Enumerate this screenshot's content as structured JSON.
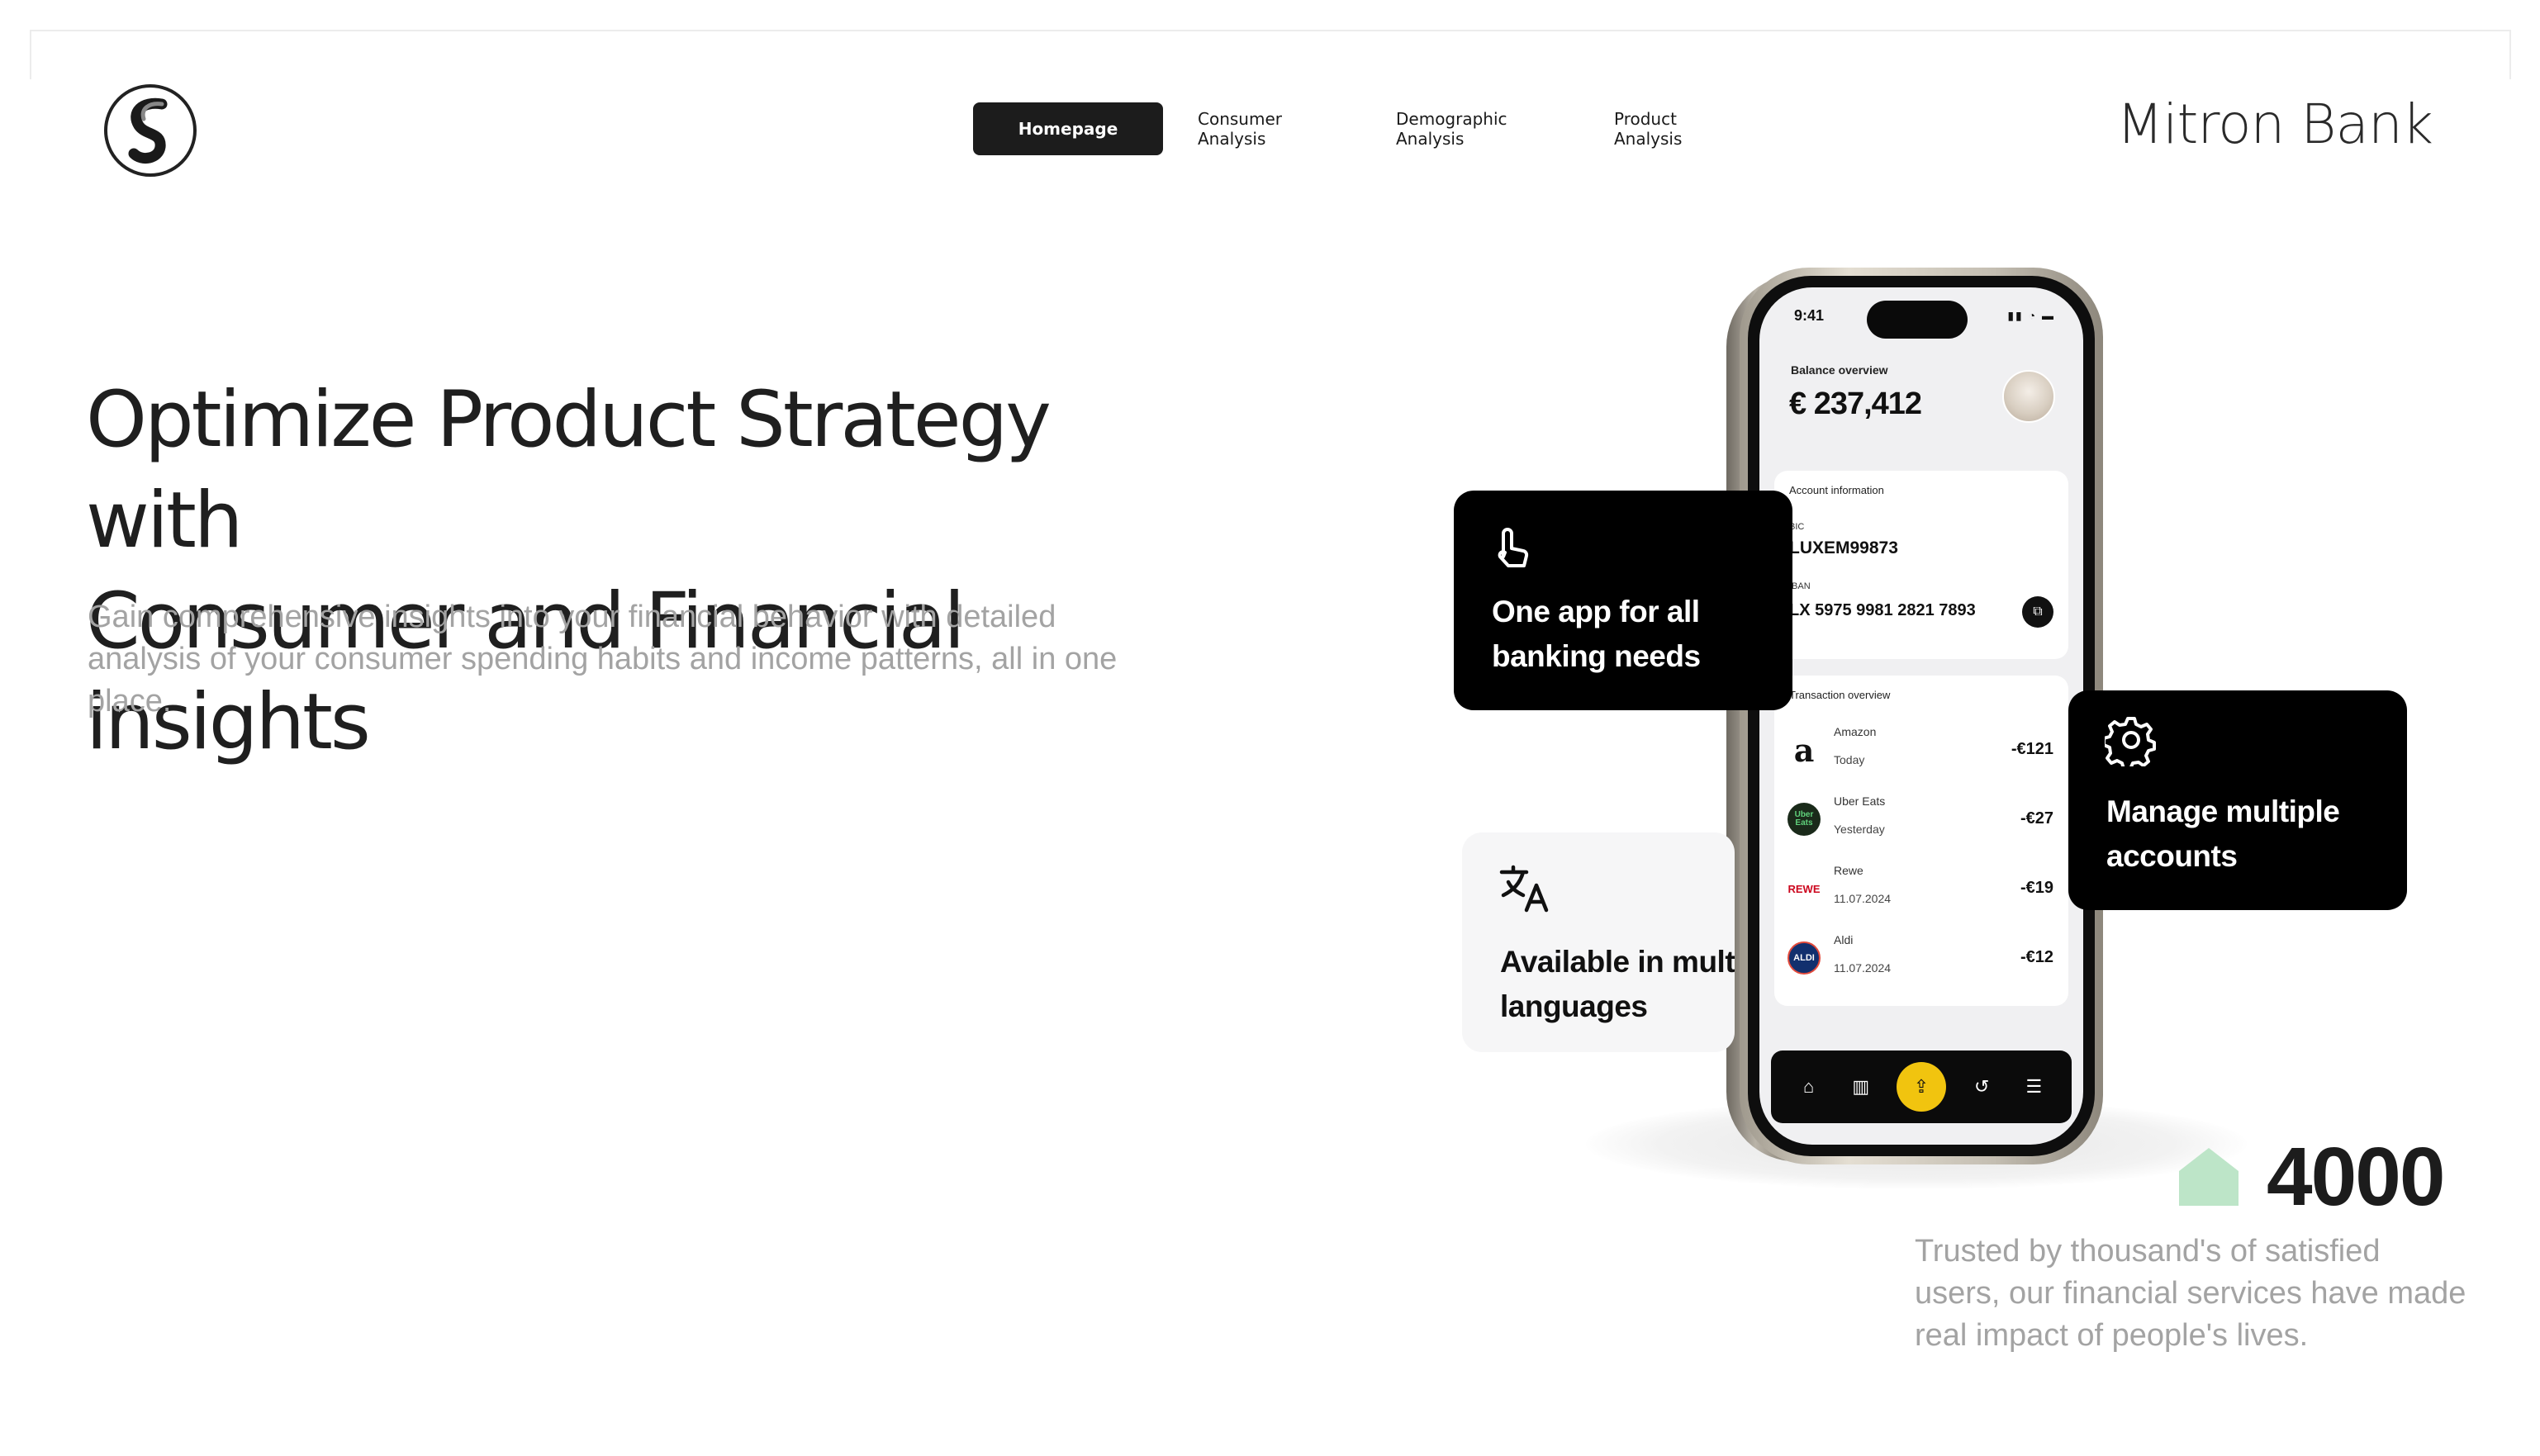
{
  "nav": {
    "items": [
      {
        "label": "Homepage",
        "active": true
      },
      {
        "label": "Consumer Analysis",
        "active": false
      },
      {
        "label": "Demographic Analysis",
        "active": false
      },
      {
        "label": "Product Analysis",
        "active": false
      }
    ],
    "active_color": "#1c1c1c"
  },
  "brand": {
    "name": "Mitron Bank",
    "logo_icon": "s-monogram-logo"
  },
  "hero": {
    "title_line1": "Optimize Product Strategy with",
    "title_line2": "Consumer and Financial insights",
    "subtitle": "Gain comprehensive insights into your financial behavior with detailed analysis of your consumer spending habits and income patterns, all in one place."
  },
  "phone": {
    "time": "9:41",
    "balance_label": "Balance overview",
    "balance_value": "€ 237,412",
    "account_header": "Account information",
    "bic_label": "BIC",
    "bic_value": "LUXEM99873",
    "iban_label": "IBAN",
    "iban_value": "LX 5975 9981 2821 7893",
    "tx_header": "Transaction overview",
    "transactions": [
      {
        "name": "Amazon",
        "date": "Today",
        "amount": "-€121",
        "icon": "amazon-logo"
      },
      {
        "name": "Uber Eats",
        "date": "Yesterday",
        "amount": "-€27",
        "icon": "uber-eats-logo"
      },
      {
        "name": "Rewe",
        "date": "11.07.2024",
        "amount": "-€19",
        "icon": "rewe-logo",
        "logo_text": "REWE"
      },
      {
        "name": "Aldi",
        "date": "11.07.2024",
        "amount": "-€12",
        "icon": "aldi-logo",
        "logo_text": "ALDI"
      }
    ],
    "tabbar_icons": [
      "home-icon",
      "chart-icon",
      "transfer-icon",
      "history-icon",
      "menu-icon"
    ],
    "tab_accent": "#f1c40f"
  },
  "features": {
    "one_app": "One app for all banking needs",
    "one_app_icon": "tap-hand-icon",
    "manage": "Manage multiple accounts",
    "manage_icon": "gear-icon",
    "languages": "Available in multiple languages",
    "languages_icon": "translate-icon"
  },
  "stats": {
    "value": "4000",
    "icon": "house-icon",
    "icon_color": "#bde5c8",
    "text": "Trusted by thousand's of satisfied users, our financial services have made real impact of people's lives."
  }
}
